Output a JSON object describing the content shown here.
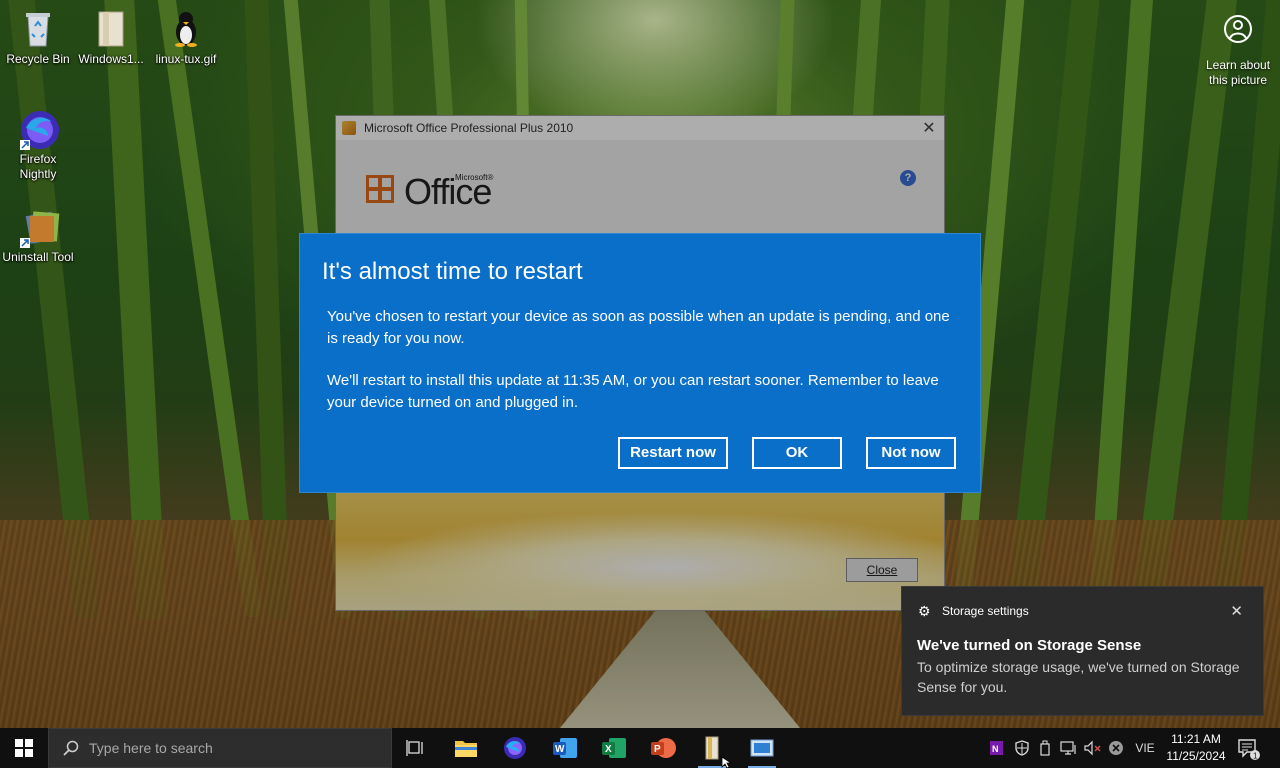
{
  "desktop": {
    "icons": [
      {
        "label": "Recycle Bin"
      },
      {
        "label": "Windows1..."
      },
      {
        "label": "linux-tux.gif"
      },
      {
        "label": "Firefox Nightly"
      },
      {
        "label": "Uninstall Tool"
      }
    ],
    "learn_about": "Learn about this picture"
  },
  "office_window": {
    "title": "Microsoft Office Professional Plus 2010",
    "logo_text": "Office",
    "logo_super": "Microsoft®",
    "help_glyph": "?",
    "close_label": "Close"
  },
  "restart_dialog": {
    "title": "It's almost time to restart",
    "paragraph1": "You've chosen to restart your device as soon as possible when an update is pending, and one is ready for you now.",
    "paragraph2": "We'll restart to install this update at 11:35 AM, or you can restart sooner. Remember to leave your device turned on and plugged in.",
    "buttons": {
      "restart_now": "Restart now",
      "ok": "OK",
      "not_now": "Not now"
    }
  },
  "toast": {
    "header": "Storage settings",
    "title": "We've turned on Storage Sense",
    "body": "To optimize storage usage, we've turned on Storage Sense for you."
  },
  "taskbar": {
    "search_placeholder": "Type here to search",
    "apps": [
      "task-view",
      "file-explorer",
      "firefox",
      "word",
      "excel",
      "powerpoint",
      "windows-folder",
      "remote-app"
    ],
    "language": "VIE",
    "time": "11:21 AM",
    "date": "11/25/2024",
    "notification_count": "1"
  },
  "colors": {
    "dialog_blue": "#0a6fc9",
    "taskbar": "#101010",
    "toast_bg": "#2b2b2b"
  }
}
